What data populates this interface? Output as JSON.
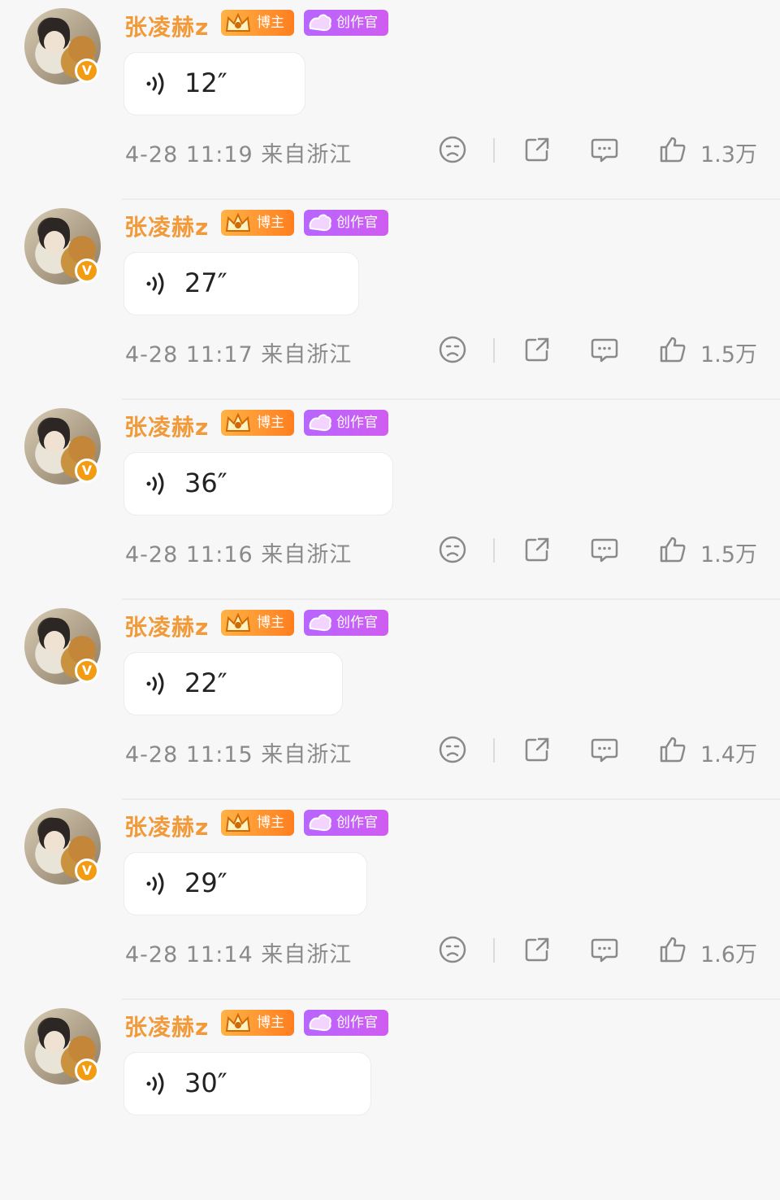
{
  "posts": [
    {
      "username": "张凌赫z",
      "badge_blogger": "博主",
      "badge_creator": "创作官",
      "duration": "12″",
      "time": "4-28 11:19",
      "location": "来自浙江",
      "likes": "1.3万",
      "voice_width": 224
    },
    {
      "username": "张凌赫z",
      "badge_blogger": "博主",
      "badge_creator": "创作官",
      "duration": "27″",
      "time": "4-28 11:17",
      "location": "来自浙江",
      "likes": "1.5万",
      "voice_width": 290
    },
    {
      "username": "张凌赫z",
      "badge_blogger": "博主",
      "badge_creator": "创作官",
      "duration": "36″",
      "time": "4-28 11:16",
      "location": "来自浙江",
      "likes": "1.5万",
      "voice_width": 332
    },
    {
      "username": "张凌赫z",
      "badge_blogger": "博主",
      "badge_creator": "创作官",
      "duration": "22″",
      "time": "4-28 11:15",
      "location": "来自浙江",
      "likes": "1.4万",
      "voice_width": 270
    },
    {
      "username": "张凌赫z",
      "badge_blogger": "博主",
      "badge_creator": "创作官",
      "duration": "29″",
      "time": "4-28 11:14",
      "location": "来自浙江",
      "likes": "1.6万",
      "voice_width": 300
    },
    {
      "username": "张凌赫z",
      "badge_blogger": "博主",
      "badge_creator": "创作官",
      "duration": "30″",
      "time": "",
      "location": "",
      "likes": "",
      "voice_width": 305
    }
  ],
  "icons": {
    "voice": "voice-wave-icon",
    "verify": "verified-v-icon",
    "dislike": "sad-face-icon",
    "share": "share-icon",
    "comment": "comment-icon",
    "like": "thumbs-up-icon"
  },
  "colors": {
    "username": "#f09a3a",
    "blogger_badge": "#ff8c2a",
    "creator_badge": "#c05ff5",
    "verify": "#f39c12",
    "meta_text": "#8a8a8a"
  },
  "verify_glyph": "V"
}
